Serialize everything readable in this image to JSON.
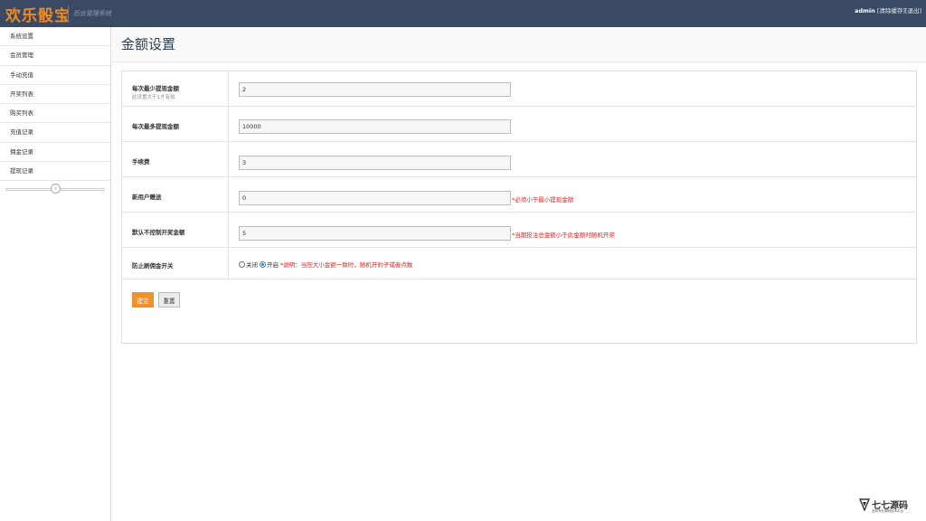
{
  "header": {
    "brand": "欢乐骰宝",
    "subtitle": "后台管理系统",
    "user": "admin",
    "links": [
      "[清除缓存]",
      "[退出]"
    ]
  },
  "sidebar": {
    "items": [
      {
        "label": "系统设置"
      },
      {
        "label": "会员管理"
      },
      {
        "label": "手动充值"
      },
      {
        "label": "开奖列表"
      },
      {
        "label": "购买列表"
      },
      {
        "label": "充值记录"
      },
      {
        "label": "佣金记录"
      },
      {
        "label": "提现记录"
      }
    ],
    "collapse_icon": "chevron-left-icon"
  },
  "main": {
    "title": "金额设置",
    "fields": [
      {
        "label": "每次最少提现金额",
        "hint": "此设置大于1才有效",
        "value": "2",
        "warning": ""
      },
      {
        "label": "每次最多提现金额",
        "hint": "",
        "value": "10000",
        "warning": ""
      },
      {
        "label": "手续费",
        "hint": "",
        "value": "3",
        "warning": ""
      },
      {
        "label": "新用户赠送",
        "hint": "",
        "value": "0",
        "warning": "*必须小于最小提现金额"
      },
      {
        "label": "默认不控制开奖金额",
        "hint": "",
        "value": "5",
        "warning": "*当期投注总金额小于此金额时随机开奖"
      }
    ],
    "switch": {
      "label": "防止刷佣金开关",
      "options": [
        "关闭",
        "开启"
      ],
      "selected": "开启",
      "note": "*说明：当压大小金额一致时，随机开豹子或者点数"
    },
    "buttons": {
      "submit": "提交",
      "reset": "重置"
    }
  },
  "watermark": {
    "text": "七七源码",
    "sub": "全网专业源码技术平台"
  },
  "colors": {
    "topbar": "#3a4a64",
    "brand": "#f08a24",
    "submit": "#f0922c",
    "warning": "#e02020",
    "radio_checked": "#2d7fd8"
  }
}
